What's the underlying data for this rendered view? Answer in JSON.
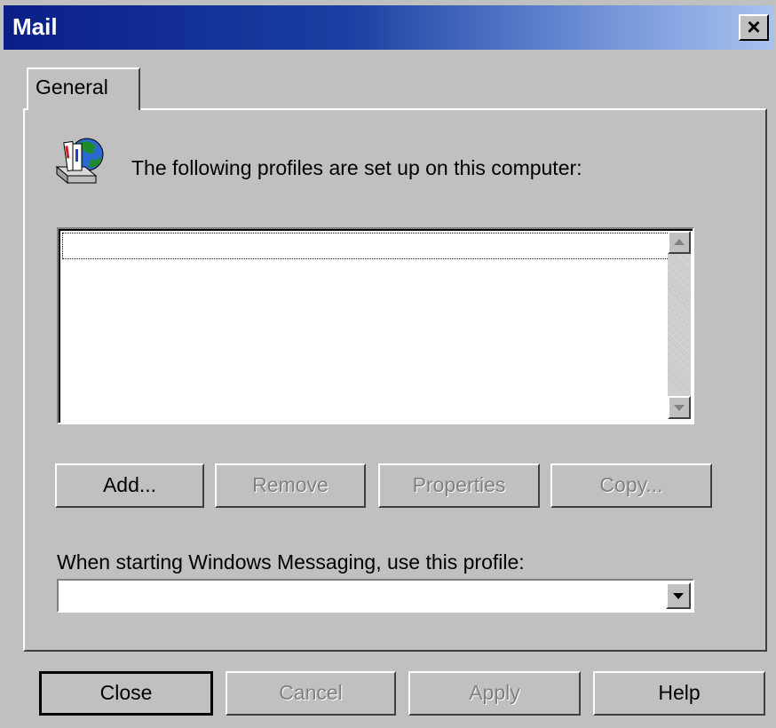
{
  "window": {
    "title": "Mail",
    "close_glyph": "×"
  },
  "tabs": [
    {
      "label": "General",
      "active": true
    }
  ],
  "general": {
    "icon": "mail-profile-icon",
    "intro_text": "The following profiles are set up on this computer:",
    "profiles": [],
    "buttons": {
      "add": "Add...",
      "remove": "Remove",
      "properties": "Properties",
      "copy": "Copy..."
    },
    "startup_label": "When starting Windows Messaging, use this profile:",
    "startup_profile_value": ""
  },
  "footer": {
    "close": "Close",
    "cancel": "Cancel",
    "apply": "Apply",
    "help": "Help"
  },
  "colors": {
    "dialog_bg": "#c0c0c0",
    "title_start": "#0a1f88",
    "title_end": "#a9c3ee",
    "disabled_text": "#808080"
  }
}
